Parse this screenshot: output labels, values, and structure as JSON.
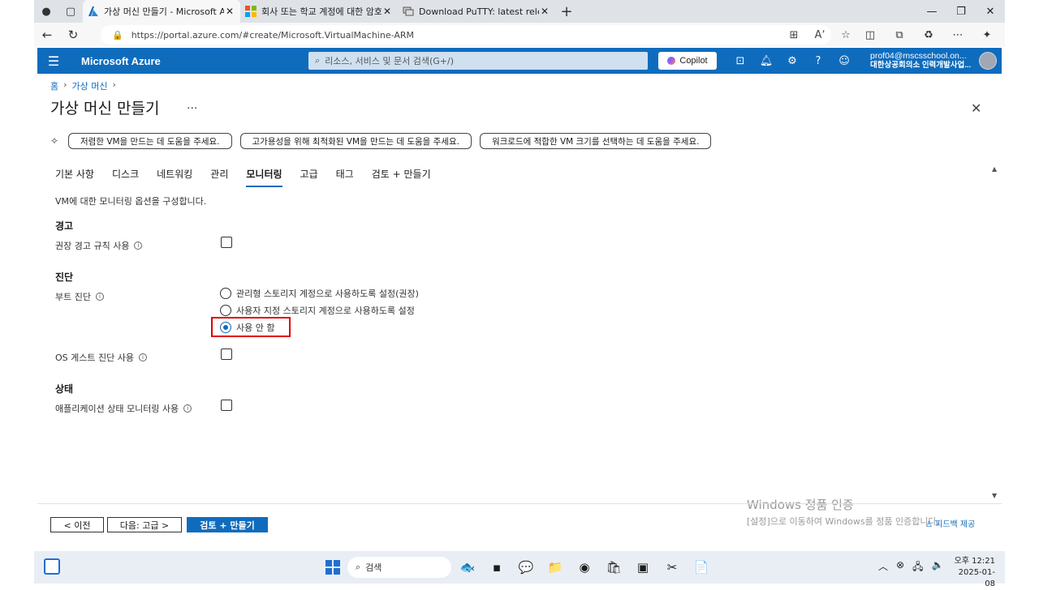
{
  "browser": {
    "tabs": [
      {
        "label": "가상 머신 만들기 - Microsoft Azure",
        "active": true
      },
      {
        "label": "회사 또는 학교 계정에 대한 암호",
        "active": false
      },
      {
        "label": "Download PuTTY: latest release (0",
        "active": false
      }
    ],
    "url": "https://portal.azure.com/#create/Microsoft.VirtualMachine-ARM"
  },
  "azure": {
    "brand": "Microsoft Azure",
    "search_placeholder": "리소스, 서비스 및 문서 검색(G+/)",
    "copilot_label": "Copilot",
    "user_email": "prof04@mscsschool.on...",
    "user_org": "대한상공회의소 인력개발사업..."
  },
  "breadcrumb": [
    "홈",
    "가상 머신"
  ],
  "page": {
    "title": "가상 머신 만들기",
    "more": "...",
    "helpers": [
      "저렴한 VM을 만드는 데 도움을 주세요.",
      "고가용성을 위해 최적화된 VM을 만드는 데 도움을 주세요.",
      "워크로드에 적합한 VM 크기를 선택하는 데 도움을 주세요."
    ],
    "tabs": [
      "기본 사항",
      "디스크",
      "네트워킹",
      "관리",
      "모니터링",
      "고급",
      "태그",
      "검토 + 만들기"
    ],
    "selected_tab": "모니터링",
    "description": "VM에 대한 모니터링 옵션을 구성합니다."
  },
  "form": {
    "alerts_heading": "경고",
    "alert_rules_label": "권장 경고 규칙 사용",
    "alert_rules_checked": false,
    "diagnostics_heading": "진단",
    "boot_diag_label": "부트 진단",
    "boot_options": [
      "관리형 스토리지 계정으로 사용하도록 설정(권장)",
      "사용자 지정 스토리지 계정으로 사용하도록 설정",
      "사용 안 함"
    ],
    "boot_selected_index": 2,
    "guest_diag_label": "OS 게스트 진단 사용",
    "guest_diag_checked": false,
    "health_heading": "상태",
    "app_health_label": "애플리케이션 상태 모니터링 사용",
    "app_health_checked": false
  },
  "footer": {
    "prev_label": "< 이전",
    "next_label": "다음: 고급 >",
    "review_label": "검토 + 만들기",
    "feedback_label": "피드백 제공"
  },
  "watermark": {
    "line1": "Windows 정품 인증",
    "line2": "[설정]으로 이동하여 Windows를 정품 인증합니다."
  },
  "taskbar": {
    "search_label": "검색",
    "time": "오후 12:21",
    "date": "2025-01-08"
  },
  "colors": {
    "azure_blue": "#0f6cbd",
    "highlight_red": "#e00000"
  }
}
